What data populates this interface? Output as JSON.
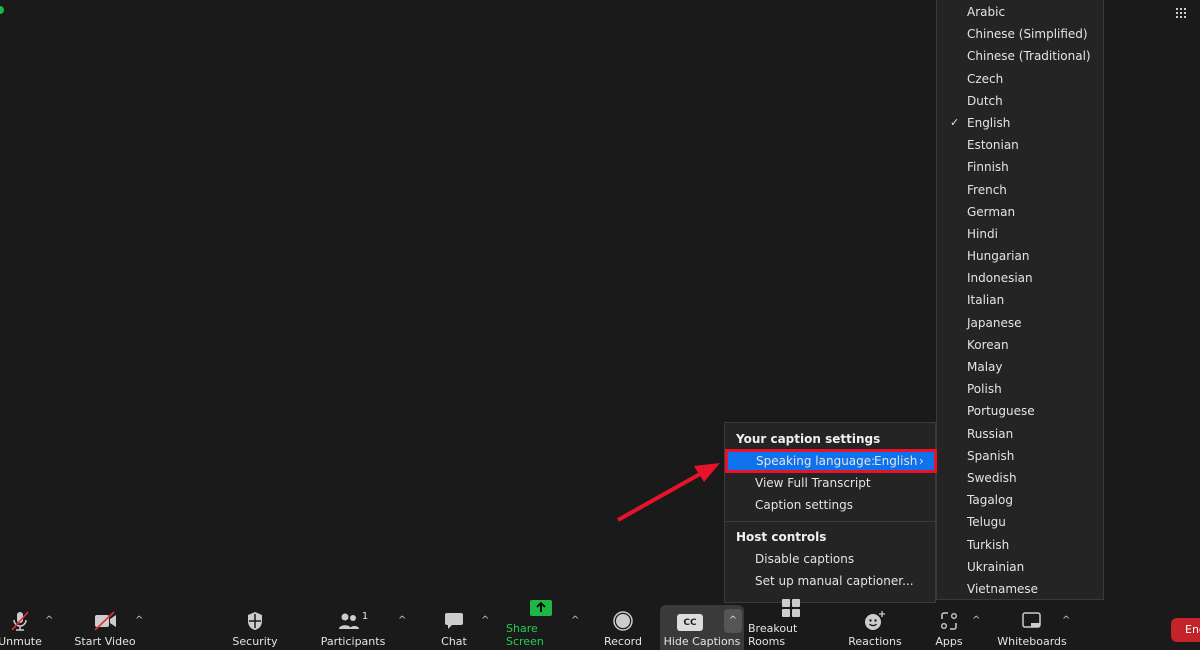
{
  "language_menu": {
    "selected": "English",
    "items": [
      "Arabic",
      "Chinese (Simplified)",
      "Chinese (Traditional)",
      "Czech",
      "Dutch",
      "English",
      "Estonian",
      "Finnish",
      "French",
      "German",
      "Hindi",
      "Hungarian",
      "Indonesian",
      "Italian",
      "Japanese",
      "Korean",
      "Malay",
      "Polish",
      "Portuguese",
      "Russian",
      "Spanish",
      "Swedish",
      "Tagalog",
      "Telugu",
      "Turkish",
      "Ukrainian",
      "Vietnamese"
    ]
  },
  "caption_menu": {
    "section1": "Your caption settings",
    "speaking_language_label": "Speaking language:",
    "speaking_language_value": "English",
    "view_transcript": "View Full Transcript",
    "caption_settings": "Caption settings",
    "section2": "Host controls",
    "disable_captions": "Disable captions",
    "manual_captioner": "Set up manual captioner..."
  },
  "toolbar": {
    "unmute": "Unmute",
    "start_video": "Start Video",
    "security": "Security",
    "participants": "Participants",
    "participants_count": "1",
    "chat": "Chat",
    "share_screen": "Share Screen",
    "record": "Record",
    "hide_captions": "Hide Captions",
    "cc": "CC",
    "breakout_rooms": "Breakout Rooms",
    "reactions": "Reactions",
    "apps": "Apps",
    "whiteboards": "Whiteboards",
    "end": "End"
  },
  "colors": {
    "accent": "#0e72ed",
    "highlight_box": "#e8132b",
    "share_green": "#1fb847",
    "end_red": "#c4232a"
  }
}
